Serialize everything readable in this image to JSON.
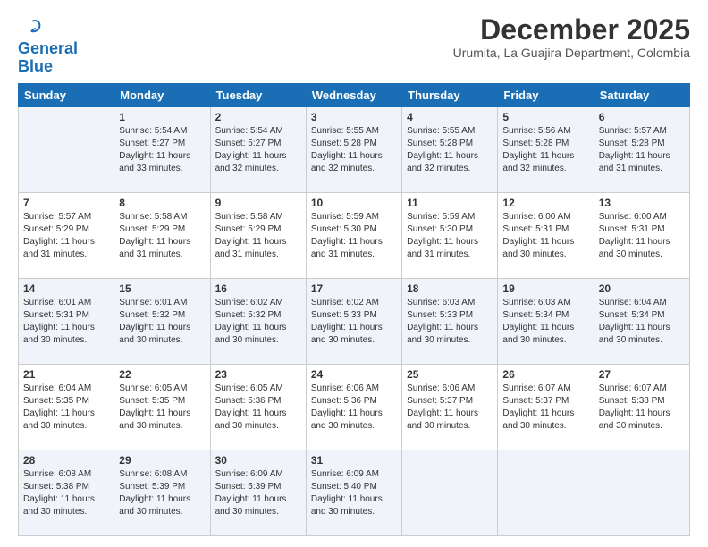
{
  "header": {
    "logo_line1": "General",
    "logo_line2": "Blue",
    "month": "December 2025",
    "location": "Urumita, La Guajira Department, Colombia"
  },
  "weekdays": [
    "Sunday",
    "Monday",
    "Tuesday",
    "Wednesday",
    "Thursday",
    "Friday",
    "Saturday"
  ],
  "weeks": [
    [
      {
        "day": "",
        "info": ""
      },
      {
        "day": "1",
        "info": "Sunrise: 5:54 AM\nSunset: 5:27 PM\nDaylight: 11 hours\nand 33 minutes."
      },
      {
        "day": "2",
        "info": "Sunrise: 5:54 AM\nSunset: 5:27 PM\nDaylight: 11 hours\nand 32 minutes."
      },
      {
        "day": "3",
        "info": "Sunrise: 5:55 AM\nSunset: 5:28 PM\nDaylight: 11 hours\nand 32 minutes."
      },
      {
        "day": "4",
        "info": "Sunrise: 5:55 AM\nSunset: 5:28 PM\nDaylight: 11 hours\nand 32 minutes."
      },
      {
        "day": "5",
        "info": "Sunrise: 5:56 AM\nSunset: 5:28 PM\nDaylight: 11 hours\nand 32 minutes."
      },
      {
        "day": "6",
        "info": "Sunrise: 5:57 AM\nSunset: 5:28 PM\nDaylight: 11 hours\nand 31 minutes."
      }
    ],
    [
      {
        "day": "7",
        "info": "Sunrise: 5:57 AM\nSunset: 5:29 PM\nDaylight: 11 hours\nand 31 minutes."
      },
      {
        "day": "8",
        "info": "Sunrise: 5:58 AM\nSunset: 5:29 PM\nDaylight: 11 hours\nand 31 minutes."
      },
      {
        "day": "9",
        "info": "Sunrise: 5:58 AM\nSunset: 5:29 PM\nDaylight: 11 hours\nand 31 minutes."
      },
      {
        "day": "10",
        "info": "Sunrise: 5:59 AM\nSunset: 5:30 PM\nDaylight: 11 hours\nand 31 minutes."
      },
      {
        "day": "11",
        "info": "Sunrise: 5:59 AM\nSunset: 5:30 PM\nDaylight: 11 hours\nand 31 minutes."
      },
      {
        "day": "12",
        "info": "Sunrise: 6:00 AM\nSunset: 5:31 PM\nDaylight: 11 hours\nand 30 minutes."
      },
      {
        "day": "13",
        "info": "Sunrise: 6:00 AM\nSunset: 5:31 PM\nDaylight: 11 hours\nand 30 minutes."
      }
    ],
    [
      {
        "day": "14",
        "info": "Sunrise: 6:01 AM\nSunset: 5:31 PM\nDaylight: 11 hours\nand 30 minutes."
      },
      {
        "day": "15",
        "info": "Sunrise: 6:01 AM\nSunset: 5:32 PM\nDaylight: 11 hours\nand 30 minutes."
      },
      {
        "day": "16",
        "info": "Sunrise: 6:02 AM\nSunset: 5:32 PM\nDaylight: 11 hours\nand 30 minutes."
      },
      {
        "day": "17",
        "info": "Sunrise: 6:02 AM\nSunset: 5:33 PM\nDaylight: 11 hours\nand 30 minutes."
      },
      {
        "day": "18",
        "info": "Sunrise: 6:03 AM\nSunset: 5:33 PM\nDaylight: 11 hours\nand 30 minutes."
      },
      {
        "day": "19",
        "info": "Sunrise: 6:03 AM\nSunset: 5:34 PM\nDaylight: 11 hours\nand 30 minutes."
      },
      {
        "day": "20",
        "info": "Sunrise: 6:04 AM\nSunset: 5:34 PM\nDaylight: 11 hours\nand 30 minutes."
      }
    ],
    [
      {
        "day": "21",
        "info": "Sunrise: 6:04 AM\nSunset: 5:35 PM\nDaylight: 11 hours\nand 30 minutes."
      },
      {
        "day": "22",
        "info": "Sunrise: 6:05 AM\nSunset: 5:35 PM\nDaylight: 11 hours\nand 30 minutes."
      },
      {
        "day": "23",
        "info": "Sunrise: 6:05 AM\nSunset: 5:36 PM\nDaylight: 11 hours\nand 30 minutes."
      },
      {
        "day": "24",
        "info": "Sunrise: 6:06 AM\nSunset: 5:36 PM\nDaylight: 11 hours\nand 30 minutes."
      },
      {
        "day": "25",
        "info": "Sunrise: 6:06 AM\nSunset: 5:37 PM\nDaylight: 11 hours\nand 30 minutes."
      },
      {
        "day": "26",
        "info": "Sunrise: 6:07 AM\nSunset: 5:37 PM\nDaylight: 11 hours\nand 30 minutes."
      },
      {
        "day": "27",
        "info": "Sunrise: 6:07 AM\nSunset: 5:38 PM\nDaylight: 11 hours\nand 30 minutes."
      }
    ],
    [
      {
        "day": "28",
        "info": "Sunrise: 6:08 AM\nSunset: 5:38 PM\nDaylight: 11 hours\nand 30 minutes."
      },
      {
        "day": "29",
        "info": "Sunrise: 6:08 AM\nSunset: 5:39 PM\nDaylight: 11 hours\nand 30 minutes."
      },
      {
        "day": "30",
        "info": "Sunrise: 6:09 AM\nSunset: 5:39 PM\nDaylight: 11 hours\nand 30 minutes."
      },
      {
        "day": "31",
        "info": "Sunrise: 6:09 AM\nSunset: 5:40 PM\nDaylight: 11 hours\nand 30 minutes."
      },
      {
        "day": "",
        "info": ""
      },
      {
        "day": "",
        "info": ""
      },
      {
        "day": "",
        "info": ""
      }
    ]
  ]
}
